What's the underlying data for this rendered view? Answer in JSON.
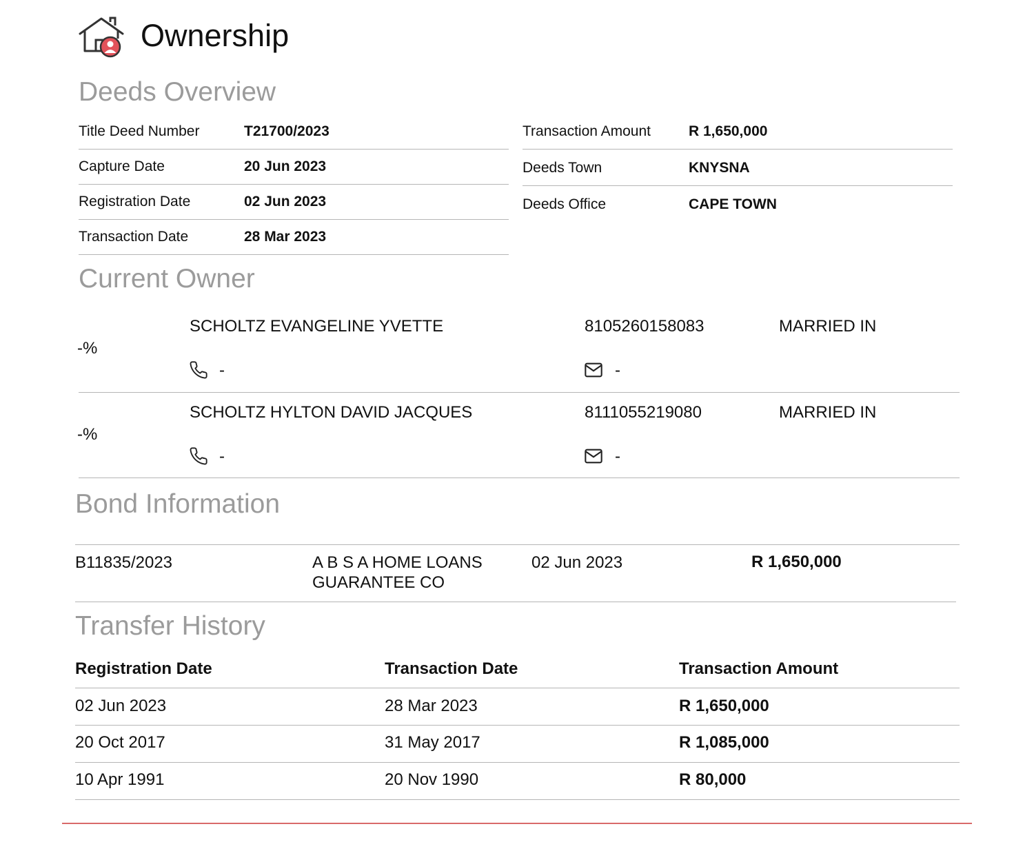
{
  "header": {
    "title": "Ownership",
    "icon": "house-user-icon",
    "accent_color": "#e2525a"
  },
  "deeds_overview": {
    "title": "Deeds Overview",
    "left": [
      {
        "label": "Title Deed Number",
        "value": "T21700/2023"
      },
      {
        "label": "Capture Date",
        "value": "20 Jun 2023"
      },
      {
        "label": "Registration Date",
        "value": "02 Jun 2023"
      },
      {
        "label": "Transaction Date",
        "value": "28 Mar 2023"
      }
    ],
    "right": [
      {
        "label": "Transaction Amount",
        "value": "R 1,650,000"
      },
      {
        "label": "Deeds Town",
        "value": "KNYSNA"
      },
      {
        "label": "Deeds Office",
        "value": "CAPE TOWN"
      }
    ]
  },
  "current_owner": {
    "title": "Current Owner",
    "owners": [
      {
        "share": "-%",
        "name": "SCHOLTZ EVANGELINE YVETTE",
        "id_number": "8105260158083",
        "marital_status": "MARRIED IN",
        "phone": "-",
        "email": "-"
      },
      {
        "share": "-%",
        "name": "SCHOLTZ HYLTON DAVID JACQUES",
        "id_number": "8111055219080",
        "marital_status": "MARRIED IN",
        "phone": "-",
        "email": "-"
      }
    ]
  },
  "bond_information": {
    "title": "Bond Information",
    "bonds": [
      {
        "bond_number": "B11835/2023",
        "lender_line1": "A B S A HOME LOANS",
        "lender_line2": "GUARANTEE CO",
        "date": "02 Jun 2023",
        "amount": "R 1,650,000"
      }
    ]
  },
  "transfer_history": {
    "title": "Transfer History",
    "columns": [
      "Registration Date",
      "Transaction Date",
      "Transaction Amount"
    ],
    "rows": [
      [
        "02 Jun 2023",
        "28 Mar 2023",
        "R 1,650,000"
      ],
      [
        "20 Oct 2017",
        "31 May 2017",
        "R 1,085,000"
      ],
      [
        "10 Apr 1991",
        "20 Nov 1990",
        "R 80,000"
      ]
    ]
  }
}
